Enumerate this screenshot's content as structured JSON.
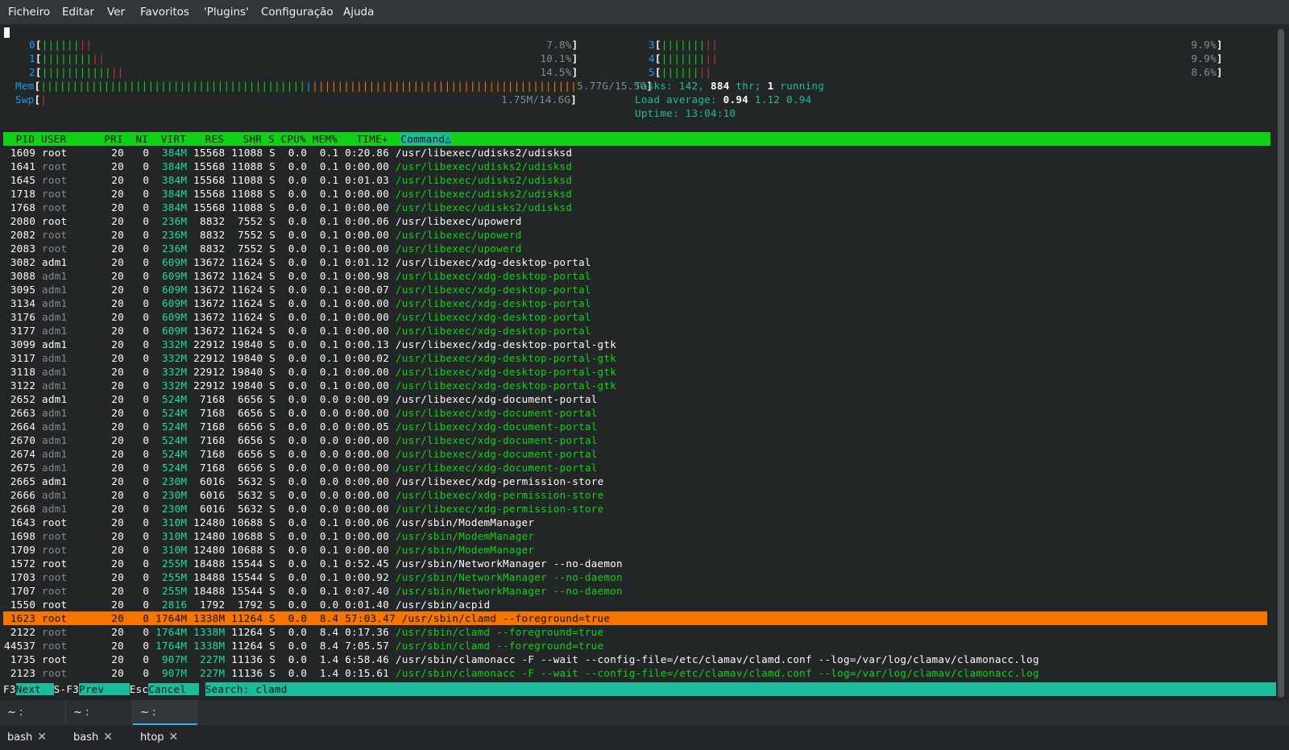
{
  "menubar": {
    "items": [
      "Ficheiro",
      "Editar",
      "Ver",
      "Favoritos",
      "'Plugins'",
      "Configuração",
      "Ajuda"
    ]
  },
  "meters": {
    "cpus": [
      {
        "id": "0",
        "percent": "7.8%",
        "green_bars": 6,
        "red_bars": 2
      },
      {
        "id": "1",
        "percent": "10.1%",
        "green_bars": 8,
        "red_bars": 2
      },
      {
        "id": "2",
        "percent": "14.5%",
        "green_bars": 11,
        "red_bars": 2
      },
      {
        "id": "3",
        "percent": "9.9%",
        "green_bars": 7,
        "red_bars": 2
      },
      {
        "id": "4",
        "percent": "9.9%",
        "green_bars": 7,
        "red_bars": 2
      },
      {
        "id": "5",
        "percent": "8.6%",
        "green_bars": 6,
        "red_bars": 2
      }
    ],
    "mem": {
      "label": "Mem",
      "value": "5.77G/15.5G",
      "green_bars": 42,
      "blue_bars": 1,
      "orange_bars": 42
    },
    "swp": {
      "label": "Swp",
      "value": "1.75M/14.6G",
      "red_bars": 1
    },
    "tasks": {
      "label": "Tasks:",
      "count": "142,",
      "threads": "884",
      "thr_label": "thr;",
      "running": "1",
      "running_label": "running"
    },
    "load": {
      "label": "Load average:",
      "v1": "0.94",
      "v2": "1.12",
      "v3": "0.94"
    },
    "uptime": {
      "label": "Uptime:",
      "value": "13:04:10"
    }
  },
  "header": {
    "columns": "  PID USER      PRI  NI  VIRT   RES   SHR S CPU% MEM%   TIME+  ",
    "sort_column": "Command△"
  },
  "processes": [
    {
      "pid": "1609",
      "user": "root",
      "pri": "20",
      "ni": "0",
      "virt": "384M",
      "res": "15568",
      "shr": "11088",
      "s": "S",
      "cpu": "0.0",
      "mem": "0.1",
      "time": "0:20.86",
      "cmd": "/usr/libexec/udisks2/udisksd",
      "thread": false
    },
    {
      "pid": "1641",
      "user": "root",
      "pri": "20",
      "ni": "0",
      "virt": "384M",
      "res": "15568",
      "shr": "11088",
      "s": "S",
      "cpu": "0.0",
      "mem": "0.1",
      "time": "0:00.00",
      "cmd": "/usr/libexec/udisks2/udisksd",
      "thread": true
    },
    {
      "pid": "1645",
      "user": "root",
      "pri": "20",
      "ni": "0",
      "virt": "384M",
      "res": "15568",
      "shr": "11088",
      "s": "S",
      "cpu": "0.0",
      "mem": "0.1",
      "time": "0:01.03",
      "cmd": "/usr/libexec/udisks2/udisksd",
      "thread": true
    },
    {
      "pid": "1718",
      "user": "root",
      "pri": "20",
      "ni": "0",
      "virt": "384M",
      "res": "15568",
      "shr": "11088",
      "s": "S",
      "cpu": "0.0",
      "mem": "0.1",
      "time": "0:00.00",
      "cmd": "/usr/libexec/udisks2/udisksd",
      "thread": true
    },
    {
      "pid": "1768",
      "user": "root",
      "pri": "20",
      "ni": "0",
      "virt": "384M",
      "res": "15568",
      "shr": "11088",
      "s": "S",
      "cpu": "0.0",
      "mem": "0.1",
      "time": "0:00.00",
      "cmd": "/usr/libexec/udisks2/udisksd",
      "thread": true
    },
    {
      "pid": "2080",
      "user": "root",
      "pri": "20",
      "ni": "0",
      "virt": "236M",
      "res": "8832",
      "shr": "7552",
      "s": "S",
      "cpu": "0.0",
      "mem": "0.1",
      "time": "0:00.06",
      "cmd": "/usr/libexec/upowerd",
      "thread": false
    },
    {
      "pid": "2082",
      "user": "root",
      "pri": "20",
      "ni": "0",
      "virt": "236M",
      "res": "8832",
      "shr": "7552",
      "s": "S",
      "cpu": "0.0",
      "mem": "0.1",
      "time": "0:00.00",
      "cmd": "/usr/libexec/upowerd",
      "thread": true
    },
    {
      "pid": "2083",
      "user": "root",
      "pri": "20",
      "ni": "0",
      "virt": "236M",
      "res": "8832",
      "shr": "7552",
      "s": "S",
      "cpu": "0.0",
      "mem": "0.1",
      "time": "0:00.00",
      "cmd": "/usr/libexec/upowerd",
      "thread": true
    },
    {
      "pid": "3082",
      "user": "adm1",
      "pri": "20",
      "ni": "0",
      "virt": "609M",
      "res": "13672",
      "shr": "11624",
      "s": "S",
      "cpu": "0.0",
      "mem": "0.1",
      "time": "0:01.12",
      "cmd": "/usr/libexec/xdg-desktop-portal",
      "thread": false
    },
    {
      "pid": "3088",
      "user": "adm1",
      "pri": "20",
      "ni": "0",
      "virt": "609M",
      "res": "13672",
      "shr": "11624",
      "s": "S",
      "cpu": "0.0",
      "mem": "0.1",
      "time": "0:00.98",
      "cmd": "/usr/libexec/xdg-desktop-portal",
      "thread": true
    },
    {
      "pid": "3095",
      "user": "adm1",
      "pri": "20",
      "ni": "0",
      "virt": "609M",
      "res": "13672",
      "shr": "11624",
      "s": "S",
      "cpu": "0.0",
      "mem": "0.1",
      "time": "0:00.07",
      "cmd": "/usr/libexec/xdg-desktop-portal",
      "thread": true
    },
    {
      "pid": "3134",
      "user": "adm1",
      "pri": "20",
      "ni": "0",
      "virt": "609M",
      "res": "13672",
      "shr": "11624",
      "s": "S",
      "cpu": "0.0",
      "mem": "0.1",
      "time": "0:00.00",
      "cmd": "/usr/libexec/xdg-desktop-portal",
      "thread": true
    },
    {
      "pid": "3176",
      "user": "adm1",
      "pri": "20",
      "ni": "0",
      "virt": "609M",
      "res": "13672",
      "shr": "11624",
      "s": "S",
      "cpu": "0.0",
      "mem": "0.1",
      "time": "0:00.00",
      "cmd": "/usr/libexec/xdg-desktop-portal",
      "thread": true
    },
    {
      "pid": "3177",
      "user": "adm1",
      "pri": "20",
      "ni": "0",
      "virt": "609M",
      "res": "13672",
      "shr": "11624",
      "s": "S",
      "cpu": "0.0",
      "mem": "0.1",
      "time": "0:00.00",
      "cmd": "/usr/libexec/xdg-desktop-portal",
      "thread": true
    },
    {
      "pid": "3099",
      "user": "adm1",
      "pri": "20",
      "ni": "0",
      "virt": "332M",
      "res": "22912",
      "shr": "19840",
      "s": "S",
      "cpu": "0.0",
      "mem": "0.1",
      "time": "0:00.13",
      "cmd": "/usr/libexec/xdg-desktop-portal-gtk",
      "thread": false
    },
    {
      "pid": "3117",
      "user": "adm1",
      "pri": "20",
      "ni": "0",
      "virt": "332M",
      "res": "22912",
      "shr": "19840",
      "s": "S",
      "cpu": "0.0",
      "mem": "0.1",
      "time": "0:00.02",
      "cmd": "/usr/libexec/xdg-desktop-portal-gtk",
      "thread": true
    },
    {
      "pid": "3118",
      "user": "adm1",
      "pri": "20",
      "ni": "0",
      "virt": "332M",
      "res": "22912",
      "shr": "19840",
      "s": "S",
      "cpu": "0.0",
      "mem": "0.1",
      "time": "0:00.00",
      "cmd": "/usr/libexec/xdg-desktop-portal-gtk",
      "thread": true
    },
    {
      "pid": "3122",
      "user": "adm1",
      "pri": "20",
      "ni": "0",
      "virt": "332M",
      "res": "22912",
      "shr": "19840",
      "s": "S",
      "cpu": "0.0",
      "mem": "0.1",
      "time": "0:00.00",
      "cmd": "/usr/libexec/xdg-desktop-portal-gtk",
      "thread": true
    },
    {
      "pid": "2652",
      "user": "adm1",
      "pri": "20",
      "ni": "0",
      "virt": "524M",
      "res": "7168",
      "shr": "6656",
      "s": "S",
      "cpu": "0.0",
      "mem": "0.0",
      "time": "0:00.09",
      "cmd": "/usr/libexec/xdg-document-portal",
      "thread": false
    },
    {
      "pid": "2663",
      "user": "adm1",
      "pri": "20",
      "ni": "0",
      "virt": "524M",
      "res": "7168",
      "shr": "6656",
      "s": "S",
      "cpu": "0.0",
      "mem": "0.0",
      "time": "0:00.00",
      "cmd": "/usr/libexec/xdg-document-portal",
      "thread": true
    },
    {
      "pid": "2664",
      "user": "adm1",
      "pri": "20",
      "ni": "0",
      "virt": "524M",
      "res": "7168",
      "shr": "6656",
      "s": "S",
      "cpu": "0.0",
      "mem": "0.0",
      "time": "0:00.05",
      "cmd": "/usr/libexec/xdg-document-portal",
      "thread": true
    },
    {
      "pid": "2670",
      "user": "adm1",
      "pri": "20",
      "ni": "0",
      "virt": "524M",
      "res": "7168",
      "shr": "6656",
      "s": "S",
      "cpu": "0.0",
      "mem": "0.0",
      "time": "0:00.00",
      "cmd": "/usr/libexec/xdg-document-portal",
      "thread": true
    },
    {
      "pid": "2674",
      "user": "adm1",
      "pri": "20",
      "ni": "0",
      "virt": "524M",
      "res": "7168",
      "shr": "6656",
      "s": "S",
      "cpu": "0.0",
      "mem": "0.0",
      "time": "0:00.00",
      "cmd": "/usr/libexec/xdg-document-portal",
      "thread": true
    },
    {
      "pid": "2675",
      "user": "adm1",
      "pri": "20",
      "ni": "0",
      "virt": "524M",
      "res": "7168",
      "shr": "6656",
      "s": "S",
      "cpu": "0.0",
      "mem": "0.0",
      "time": "0:00.00",
      "cmd": "/usr/libexec/xdg-document-portal",
      "thread": true
    },
    {
      "pid": "2665",
      "user": "adm1",
      "pri": "20",
      "ni": "0",
      "virt": "230M",
      "res": "6016",
      "shr": "5632",
      "s": "S",
      "cpu": "0.0",
      "mem": "0.0",
      "time": "0:00.00",
      "cmd": "/usr/libexec/xdg-permission-store",
      "thread": false
    },
    {
      "pid": "2666",
      "user": "adm1",
      "pri": "20",
      "ni": "0",
      "virt": "230M",
      "res": "6016",
      "shr": "5632",
      "s": "S",
      "cpu": "0.0",
      "mem": "0.0",
      "time": "0:00.00",
      "cmd": "/usr/libexec/xdg-permission-store",
      "thread": true
    },
    {
      "pid": "2668",
      "user": "adm1",
      "pri": "20",
      "ni": "0",
      "virt": "230M",
      "res": "6016",
      "shr": "5632",
      "s": "S",
      "cpu": "0.0",
      "mem": "0.0",
      "time": "0:00.00",
      "cmd": "/usr/libexec/xdg-permission-store",
      "thread": true
    },
    {
      "pid": "1643",
      "user": "root",
      "pri": "20",
      "ni": "0",
      "virt": "310M",
      "res": "12480",
      "shr": "10688",
      "s": "S",
      "cpu": "0.0",
      "mem": "0.1",
      "time": "0:00.06",
      "cmd": "/usr/sbin/ModemManager",
      "thread": false
    },
    {
      "pid": "1698",
      "user": "root",
      "pri": "20",
      "ni": "0",
      "virt": "310M",
      "res": "12480",
      "shr": "10688",
      "s": "S",
      "cpu": "0.0",
      "mem": "0.1",
      "time": "0:00.00",
      "cmd": "/usr/sbin/ModemManager",
      "thread": true
    },
    {
      "pid": "1709",
      "user": "root",
      "pri": "20",
      "ni": "0",
      "virt": "310M",
      "res": "12480",
      "shr": "10688",
      "s": "S",
      "cpu": "0.0",
      "mem": "0.1",
      "time": "0:00.00",
      "cmd": "/usr/sbin/ModemManager",
      "thread": true
    },
    {
      "pid": "1572",
      "user": "root",
      "pri": "20",
      "ni": "0",
      "virt": "255M",
      "res": "18488",
      "shr": "15544",
      "s": "S",
      "cpu": "0.0",
      "mem": "0.1",
      "time": "0:52.45",
      "cmd": "/usr/sbin/NetworkManager --no-daemon",
      "thread": false
    },
    {
      "pid": "1703",
      "user": "root",
      "pri": "20",
      "ni": "0",
      "virt": "255M",
      "res": "18488",
      "shr": "15544",
      "s": "S",
      "cpu": "0.0",
      "mem": "0.1",
      "time": "0:00.92",
      "cmd": "/usr/sbin/NetworkManager --no-daemon",
      "thread": true
    },
    {
      "pid": "1707",
      "user": "root",
      "pri": "20",
      "ni": "0",
      "virt": "255M",
      "res": "18488",
      "shr": "15544",
      "s": "S",
      "cpu": "0.0",
      "mem": "0.1",
      "time": "0:07.40",
      "cmd": "/usr/sbin/NetworkManager --no-daemon",
      "thread": true
    },
    {
      "pid": "1550",
      "user": "root",
      "pri": "20",
      "ni": "0",
      "virt": "2816",
      "res": "1792",
      "shr": "1792",
      "s": "S",
      "cpu": "0.0",
      "mem": "0.0",
      "time": "0:01.40",
      "cmd": "/usr/sbin/acpid",
      "thread": false
    },
    {
      "pid": "1623",
      "user": "root",
      "pri": "20",
      "ni": "0",
      "virt": "1764M",
      "res": "1338M",
      "shr": "11264",
      "s": "S",
      "cpu": "0.0",
      "mem": "8.4",
      "time": "57:03.47",
      "cmd": "/usr/sbin/clamd --foreground=true",
      "thread": false,
      "selected": true
    },
    {
      "pid": "2122",
      "user": "root",
      "pri": "20",
      "ni": "0",
      "virt": "1764M",
      "res": "1338M",
      "shr": "11264",
      "s": "S",
      "cpu": "0.0",
      "mem": "8.4",
      "time": "0:17.36",
      "cmd": "/usr/sbin/clamd --foreground=true",
      "thread": true
    },
    {
      "pid": "44537",
      "user": "root",
      "pri": "20",
      "ni": "0",
      "virt": "1764M",
      "res": "1338M",
      "shr": "11264",
      "s": "S",
      "cpu": "0.0",
      "mem": "8.4",
      "time": "7:05.57",
      "cmd": "/usr/sbin/clamd --foreground=true",
      "thread": true
    },
    {
      "pid": "1735",
      "user": "root",
      "pri": "20",
      "ni": "0",
      "virt": "907M",
      "res": "227M",
      "shr": "11136",
      "s": "S",
      "cpu": "0.0",
      "mem": "1.4",
      "time": "6:58.46",
      "cmd": "/usr/sbin/clamonacc -F --wait --config-file=/etc/clamav/clamd.conf --log=/var/log/clamav/clamonacc.log",
      "thread": false
    },
    {
      "pid": "2123",
      "user": "root",
      "pri": "20",
      "ni": "0",
      "virt": "907M",
      "res": "227M",
      "shr": "11136",
      "s": "S",
      "cpu": "0.0",
      "mem": "1.4",
      "time": "0:15.61",
      "cmd": "/usr/sbin/clamonacc -F --wait --config-file=/etc/clamav/clamd.conf --log=/var/log/clamav/clamonacc.log",
      "thread": true
    }
  ],
  "fnbar": {
    "keys": [
      {
        "key": "F3",
        "label": "Next  "
      },
      {
        "key": "S-F3",
        "label": "Prev    "
      },
      {
        "key": "Esc",
        "label": "Cancel  "
      }
    ],
    "search_label": "Search: ",
    "search_value": "clamd"
  },
  "tabs": [
    {
      "label": "~ : bash",
      "active": false
    },
    {
      "label": "~ : bash",
      "active": false
    },
    {
      "label": "~ : htop",
      "active": true
    }
  ],
  "colors": {
    "header_bg": "#11d116",
    "selected_row_bg": "#f67400",
    "thread_text": "#11d116",
    "cyan_label": "#1abc9c"
  }
}
